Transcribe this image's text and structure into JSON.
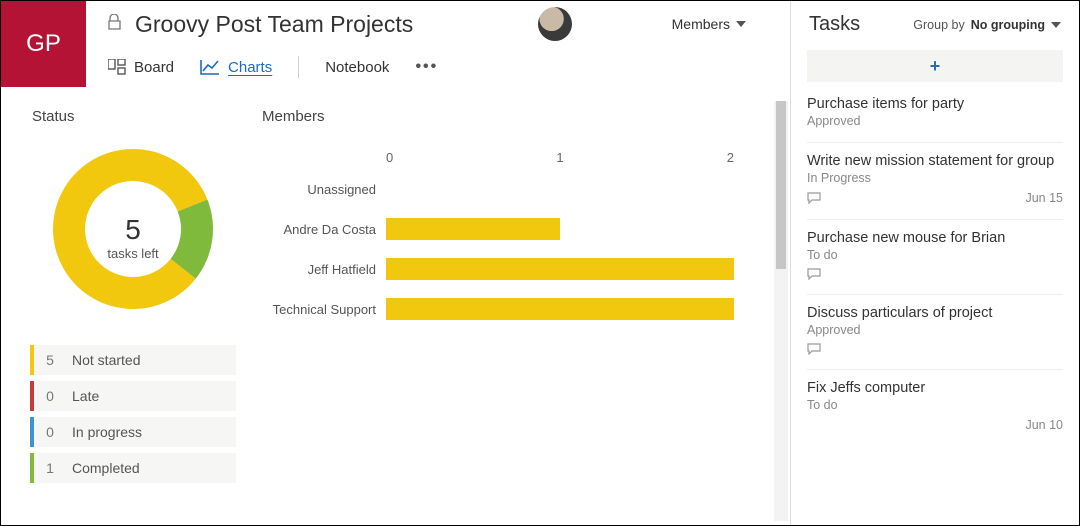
{
  "header": {
    "logo_initials": "GP",
    "title": "Groovy Post Team Projects",
    "members_label": "Members"
  },
  "tabs": {
    "board": "Board",
    "charts": "Charts",
    "notebook": "Notebook"
  },
  "status_card": {
    "title": "Status",
    "center_value": "5",
    "center_label": "tasks left",
    "legend": [
      {
        "count": "5",
        "label": "Not started",
        "color": "#f2c80f"
      },
      {
        "count": "0",
        "label": "Late",
        "color": "#c83b3b"
      },
      {
        "count": "0",
        "label": "In progress",
        "color": "#3e95cd"
      },
      {
        "count": "1",
        "label": "Completed",
        "color": "#7fba3c"
      }
    ]
  },
  "members_card": {
    "title": "Members",
    "axis": [
      "0",
      "1",
      "2"
    ]
  },
  "side": {
    "title": "Tasks",
    "group_by_label": "Group by",
    "group_by_value": "No grouping"
  },
  "tasks": [
    {
      "title": "Purchase items for party",
      "status": "Approved",
      "has_comment": false,
      "date": ""
    },
    {
      "title": "Write new mission statement for group",
      "status": "In Progress",
      "has_comment": true,
      "date": "Jun 15"
    },
    {
      "title": "Purchase new mouse for Brian",
      "status": "To do",
      "has_comment": true,
      "date": ""
    },
    {
      "title": "Discuss particulars of project",
      "status": "Approved",
      "has_comment": true,
      "date": ""
    },
    {
      "title": "Fix Jeffs computer",
      "status": "To do",
      "has_comment": false,
      "date": "Jun 10"
    }
  ],
  "chart_data": {
    "donut": {
      "type": "pie",
      "title": "Status",
      "series": [
        {
          "name": "Not started",
          "value": 5,
          "color": "#f2c80f"
        },
        {
          "name": "Completed",
          "value": 1,
          "color": "#7fba3c"
        }
      ],
      "center_value": 5,
      "center_label": "tasks left"
    },
    "members_bar": {
      "type": "bar",
      "orientation": "horizontal",
      "xlim": [
        0,
        2
      ],
      "xticks": [
        0,
        1,
        2
      ],
      "categories": [
        "Unassigned",
        "Andre Da Costa",
        "Jeff Hatfield",
        "Technical Support"
      ],
      "values": [
        0,
        1,
        2,
        2
      ],
      "color": "#f2c80f"
    }
  }
}
